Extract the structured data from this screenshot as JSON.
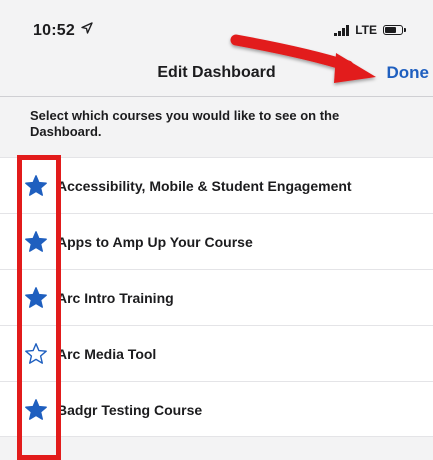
{
  "status_bar": {
    "time": "10:52",
    "network": "LTE",
    "battery_level": 0.7
  },
  "nav": {
    "title": "Edit Dashboard",
    "done_label": "Done"
  },
  "instructions": "Select which courses you would like to see on the Dashboard.",
  "courses": [
    {
      "name": "Accessibility, Mobile & Student Engagement",
      "favorite": true
    },
    {
      "name": "Apps to Amp Up Your Course",
      "favorite": true
    },
    {
      "name": "Arc Intro Training",
      "favorite": true
    },
    {
      "name": "Arc Media Tool",
      "favorite": false
    },
    {
      "name": "Badgr Testing Course",
      "favorite": true
    }
  ],
  "colors": {
    "accent": "#1f5fbf",
    "star": "#1f5fbf",
    "annotation": "#e21b1b"
  },
  "icons": {
    "star_filled": "star-filled-icon",
    "star_outline": "star-outline-icon",
    "location": "location-arrow-icon"
  }
}
